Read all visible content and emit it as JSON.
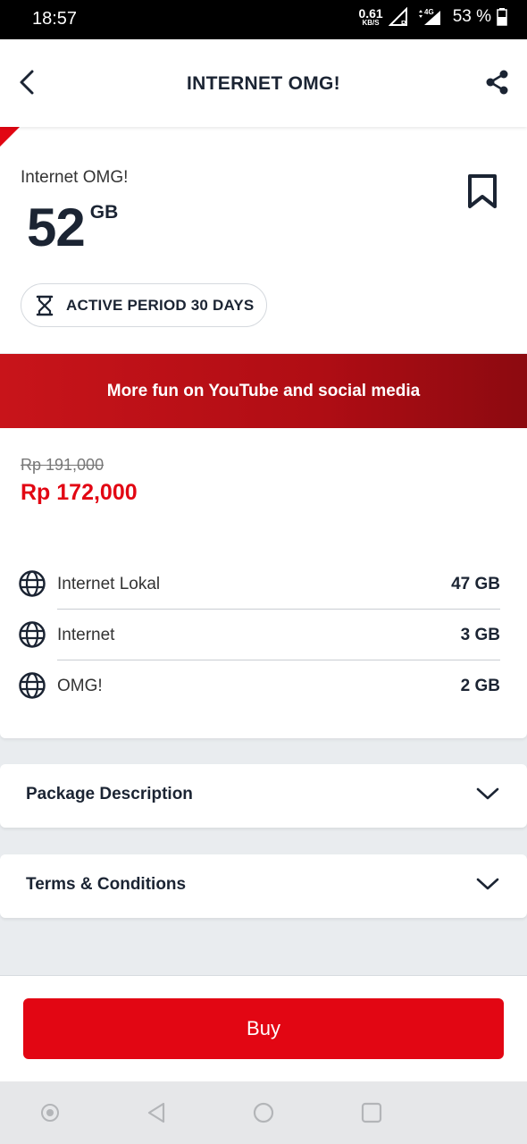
{
  "status_bar": {
    "time": "18:57",
    "net_speed_value": "0.61",
    "net_speed_unit": "KB/S",
    "battery": "53 %"
  },
  "header": {
    "title": "INTERNET OMG!",
    "back_icon": "chevron-left-icon",
    "share_icon": "share-icon"
  },
  "package": {
    "name": "Internet OMG!",
    "quota_value": "52",
    "quota_unit": "GB",
    "active_period": "ACTIVE PERIOD 30 DAYS",
    "bookmark_icon": "bookmark-icon"
  },
  "promo": {
    "text": "More fun on YouTube and social media"
  },
  "price": {
    "original": "Rp 191,000",
    "discounted": "Rp 172,000"
  },
  "benefits": [
    {
      "label": "Internet Lokal",
      "value": "47 GB",
      "icon": "globe-icon"
    },
    {
      "label": "Internet",
      "value": "3 GB",
      "icon": "globe-icon"
    },
    {
      "label": "OMG!",
      "value": "2 GB",
      "icon": "globe-icon"
    }
  ],
  "sections": [
    {
      "title": "Package Description"
    },
    {
      "title": "Terms & Conditions"
    }
  ],
  "buy": {
    "label": "Buy"
  },
  "colors": {
    "brand_red": "#e20613",
    "text_dark": "#1b2433",
    "banner_red": "#b00d14"
  }
}
